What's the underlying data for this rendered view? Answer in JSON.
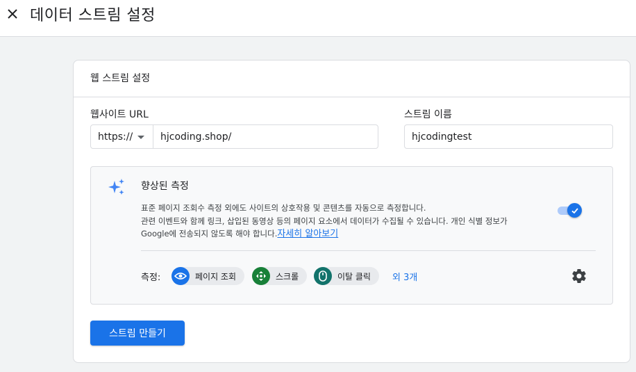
{
  "header": {
    "title": "데이터 스트림 설정",
    "close_icon": "close-icon"
  },
  "card": {
    "title": "웹 스트림 설정",
    "website_url": {
      "label": "웹사이트 URL",
      "protocol": "https://",
      "value": "hjcoding.shop/"
    },
    "stream_name": {
      "label": "스트림 이름",
      "value": "hjcodingtest"
    },
    "enhanced_measurement": {
      "icon": "sparkle-icon",
      "title": "향상된 측정",
      "description_line1": "표준 페이지 조회수 측정 외에도 사이트의 상호작용 및 콘텐츠를 자동으로 측정합니다.",
      "description_line2": "관련 이벤트와 함께 링크, 삽입된 동영상 등의 페이지 요소에서 데이터가 수집될 수 있습니다. 개인 식별 정보가",
      "description_line3": "Google에 전송되지 않도록 해야 합니다.",
      "learn_more": "자세히 알아보기",
      "enabled": true,
      "measure_label": "측정:",
      "chips": [
        {
          "label": "페이지 조회",
          "icon": "eye-icon",
          "color": "#1a73e8"
        },
        {
          "label": "스크롤",
          "icon": "scroll-crosshair-icon",
          "color": "#188038"
        },
        {
          "label": "이탈 클릭",
          "icon": "mouse-icon",
          "color": "#12736b"
        }
      ],
      "more": "외 3개",
      "settings_icon": "gear-icon"
    },
    "create_button": "스트림 만들기"
  },
  "colors": {
    "accent": "#1a73e8",
    "toggle_track": "#aecbfa",
    "background": "#f1f3f4",
    "border": "#dadce0"
  }
}
